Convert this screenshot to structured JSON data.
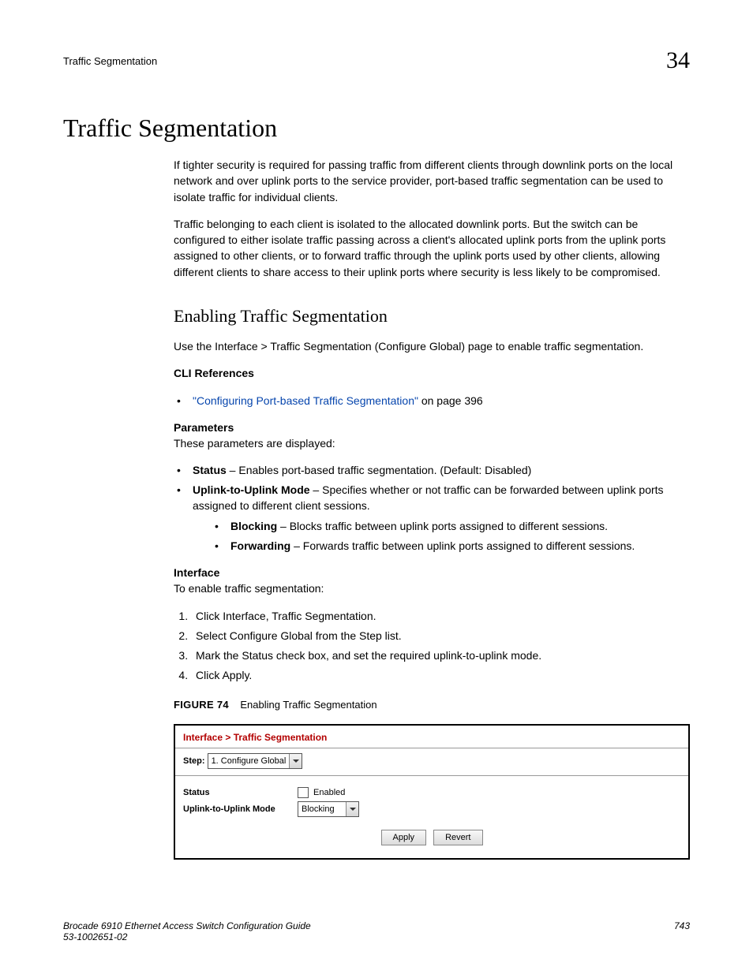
{
  "running_header": {
    "title": "Traffic Segmentation",
    "chapter": "34"
  },
  "h1": "Traffic Segmentation",
  "intro_p1": "If tighter security is required for passing traffic from different clients through downlink ports on the local network and over uplink ports to the service provider, port-based traffic segmentation can be used to isolate traffic for individual clients.",
  "intro_p2": "Traffic belonging to each client is isolated to the allocated downlink ports. But the switch can be configured to either isolate traffic passing across a client's allocated uplink ports from the uplink ports assigned to other clients, or to forward traffic through the uplink ports used by other clients, allowing different clients to share access to their uplink ports where security is less likely to be compromised.",
  "h2": "Enabling Traffic Segmentation",
  "h2_lead": "Use the Interface > Traffic Segmentation (Configure Global) page to enable traffic segmentation.",
  "cli_heading": "CLI References",
  "cli_link_text": "\"Configuring Port-based Traffic Segmentation\"",
  "cli_link_suffix": " on page 396",
  "params_heading": "Parameters",
  "params_intro": "These parameters are displayed:",
  "param1_name": "Status",
  "param1_desc": " – Enables port-based traffic segmentation. (Default: Disabled)",
  "param2_name": "Uplink-to-Uplink Mode",
  "param2_desc": " – Specifies whether or not traffic can be forwarded between uplink ports assigned to different client sessions.",
  "param2a_name": "Blocking",
  "param2a_desc": " – Blocks traffic between uplink ports assigned to different sessions.",
  "param2b_name": "Forwarding",
  "param2b_desc": " – Forwards traffic between uplink ports assigned to different sessions.",
  "interface_heading": "Interface",
  "interface_intro": "To enable traffic segmentation:",
  "steps": [
    "Click Interface, Traffic Segmentation.",
    "Select Configure Global from the Step list.",
    "Mark the Status check box, and set the required uplink-to-uplink mode.",
    "Click Apply."
  ],
  "figure_label": "FIGURE 74",
  "figure_title": "Enabling Traffic Segmentation",
  "screenshot": {
    "breadcrumb": "Interface > Traffic Segmentation",
    "step_label": "Step:",
    "step_value": "1. Configure Global",
    "status_label": "Status",
    "status_checkbox_label": "Enabled",
    "uplink_label": "Uplink-to-Uplink Mode",
    "uplink_value": "Blocking",
    "apply": "Apply",
    "revert": "Revert"
  },
  "footer": {
    "left_line1": "Brocade 6910 Ethernet Access Switch Configuration Guide",
    "left_line2": "53-1002651-02",
    "page": "743"
  }
}
